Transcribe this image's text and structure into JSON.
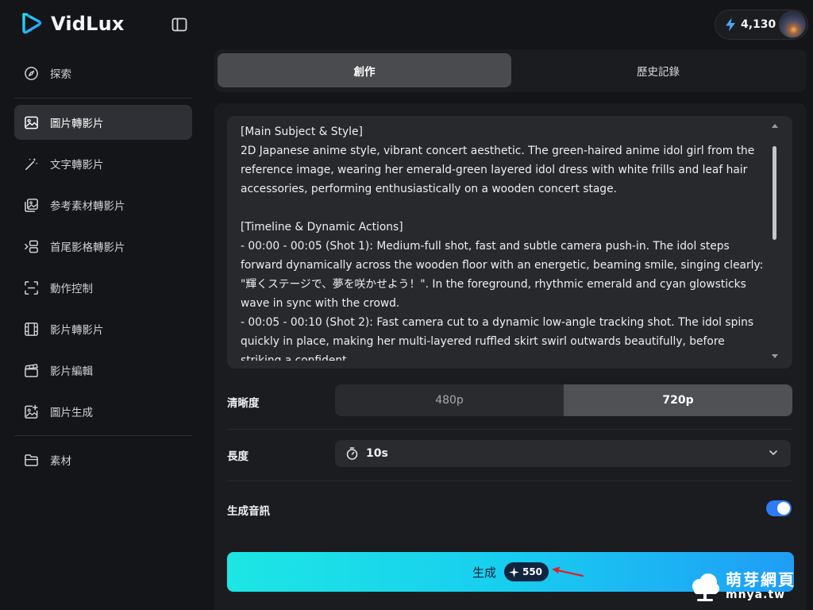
{
  "app": {
    "name": "VidLux"
  },
  "credits": {
    "amount": "4,130"
  },
  "sidebar": {
    "items": [
      {
        "label": "探索",
        "icon": "compass-icon"
      },
      {
        "label": "圖片轉影片",
        "icon": "image-icon",
        "active": true
      },
      {
        "label": "文字轉影片",
        "icon": "magic-wand-icon"
      },
      {
        "label": "参考素材轉影片",
        "icon": "gallery-icon"
      },
      {
        "label": "首尾影格轉影片",
        "icon": "frames-icon"
      },
      {
        "label": "動作控制",
        "icon": "focus-icon"
      },
      {
        "label": "影片轉影片",
        "icon": "film-icon"
      },
      {
        "label": "影片編輯",
        "icon": "clapperboard-icon"
      },
      {
        "label": "圖片生成",
        "icon": "image-plus-icon"
      },
      {
        "label": "素材",
        "icon": "folder-icon"
      }
    ]
  },
  "tabs": {
    "create": "創作",
    "history": "歷史記錄"
  },
  "prompt": {
    "text": "[Main Subject & Style]\n2D Japanese anime style, vibrant concert aesthetic. The green-haired anime idol girl from the reference image, wearing her emerald-green layered idol dress with white frills and leaf hair accessories, performing enthusiastically on a wooden concert stage.\n\n[Timeline & Dynamic Actions]\n- 00:00 - 00:05 (Shot 1): Medium-full shot, fast and subtle camera push-in. The idol steps forward dynamically across the wooden floor with an energetic, beaming smile, singing clearly: \"輝くステージで、夢を咲かせよう！\". In the foreground, rhythmic emerald and cyan glowsticks wave in sync with the crowd.\n- 00:05 - 00:10 (Shot 2): Fast camera cut to a dynamic low-angle tracking shot. The idol spins quickly in place, making her multi-layered ruffled skirt swirl outwards beautifully, before striking a confident"
  },
  "resolution": {
    "label": "清晰度",
    "options": [
      "480p",
      "720p"
    ],
    "selected": "720p"
  },
  "duration": {
    "label": "長度",
    "value": "10s"
  },
  "audio": {
    "label": "生成音訊",
    "enabled": true
  },
  "generate": {
    "label": "生成",
    "cost": "550"
  },
  "watermark": {
    "name": "萌芽網頁",
    "url": "mnya.tw"
  },
  "colors": {
    "accent": "#2f7bf3",
    "button_start": "#1de6e4",
    "button_end": "#1f9df6"
  }
}
